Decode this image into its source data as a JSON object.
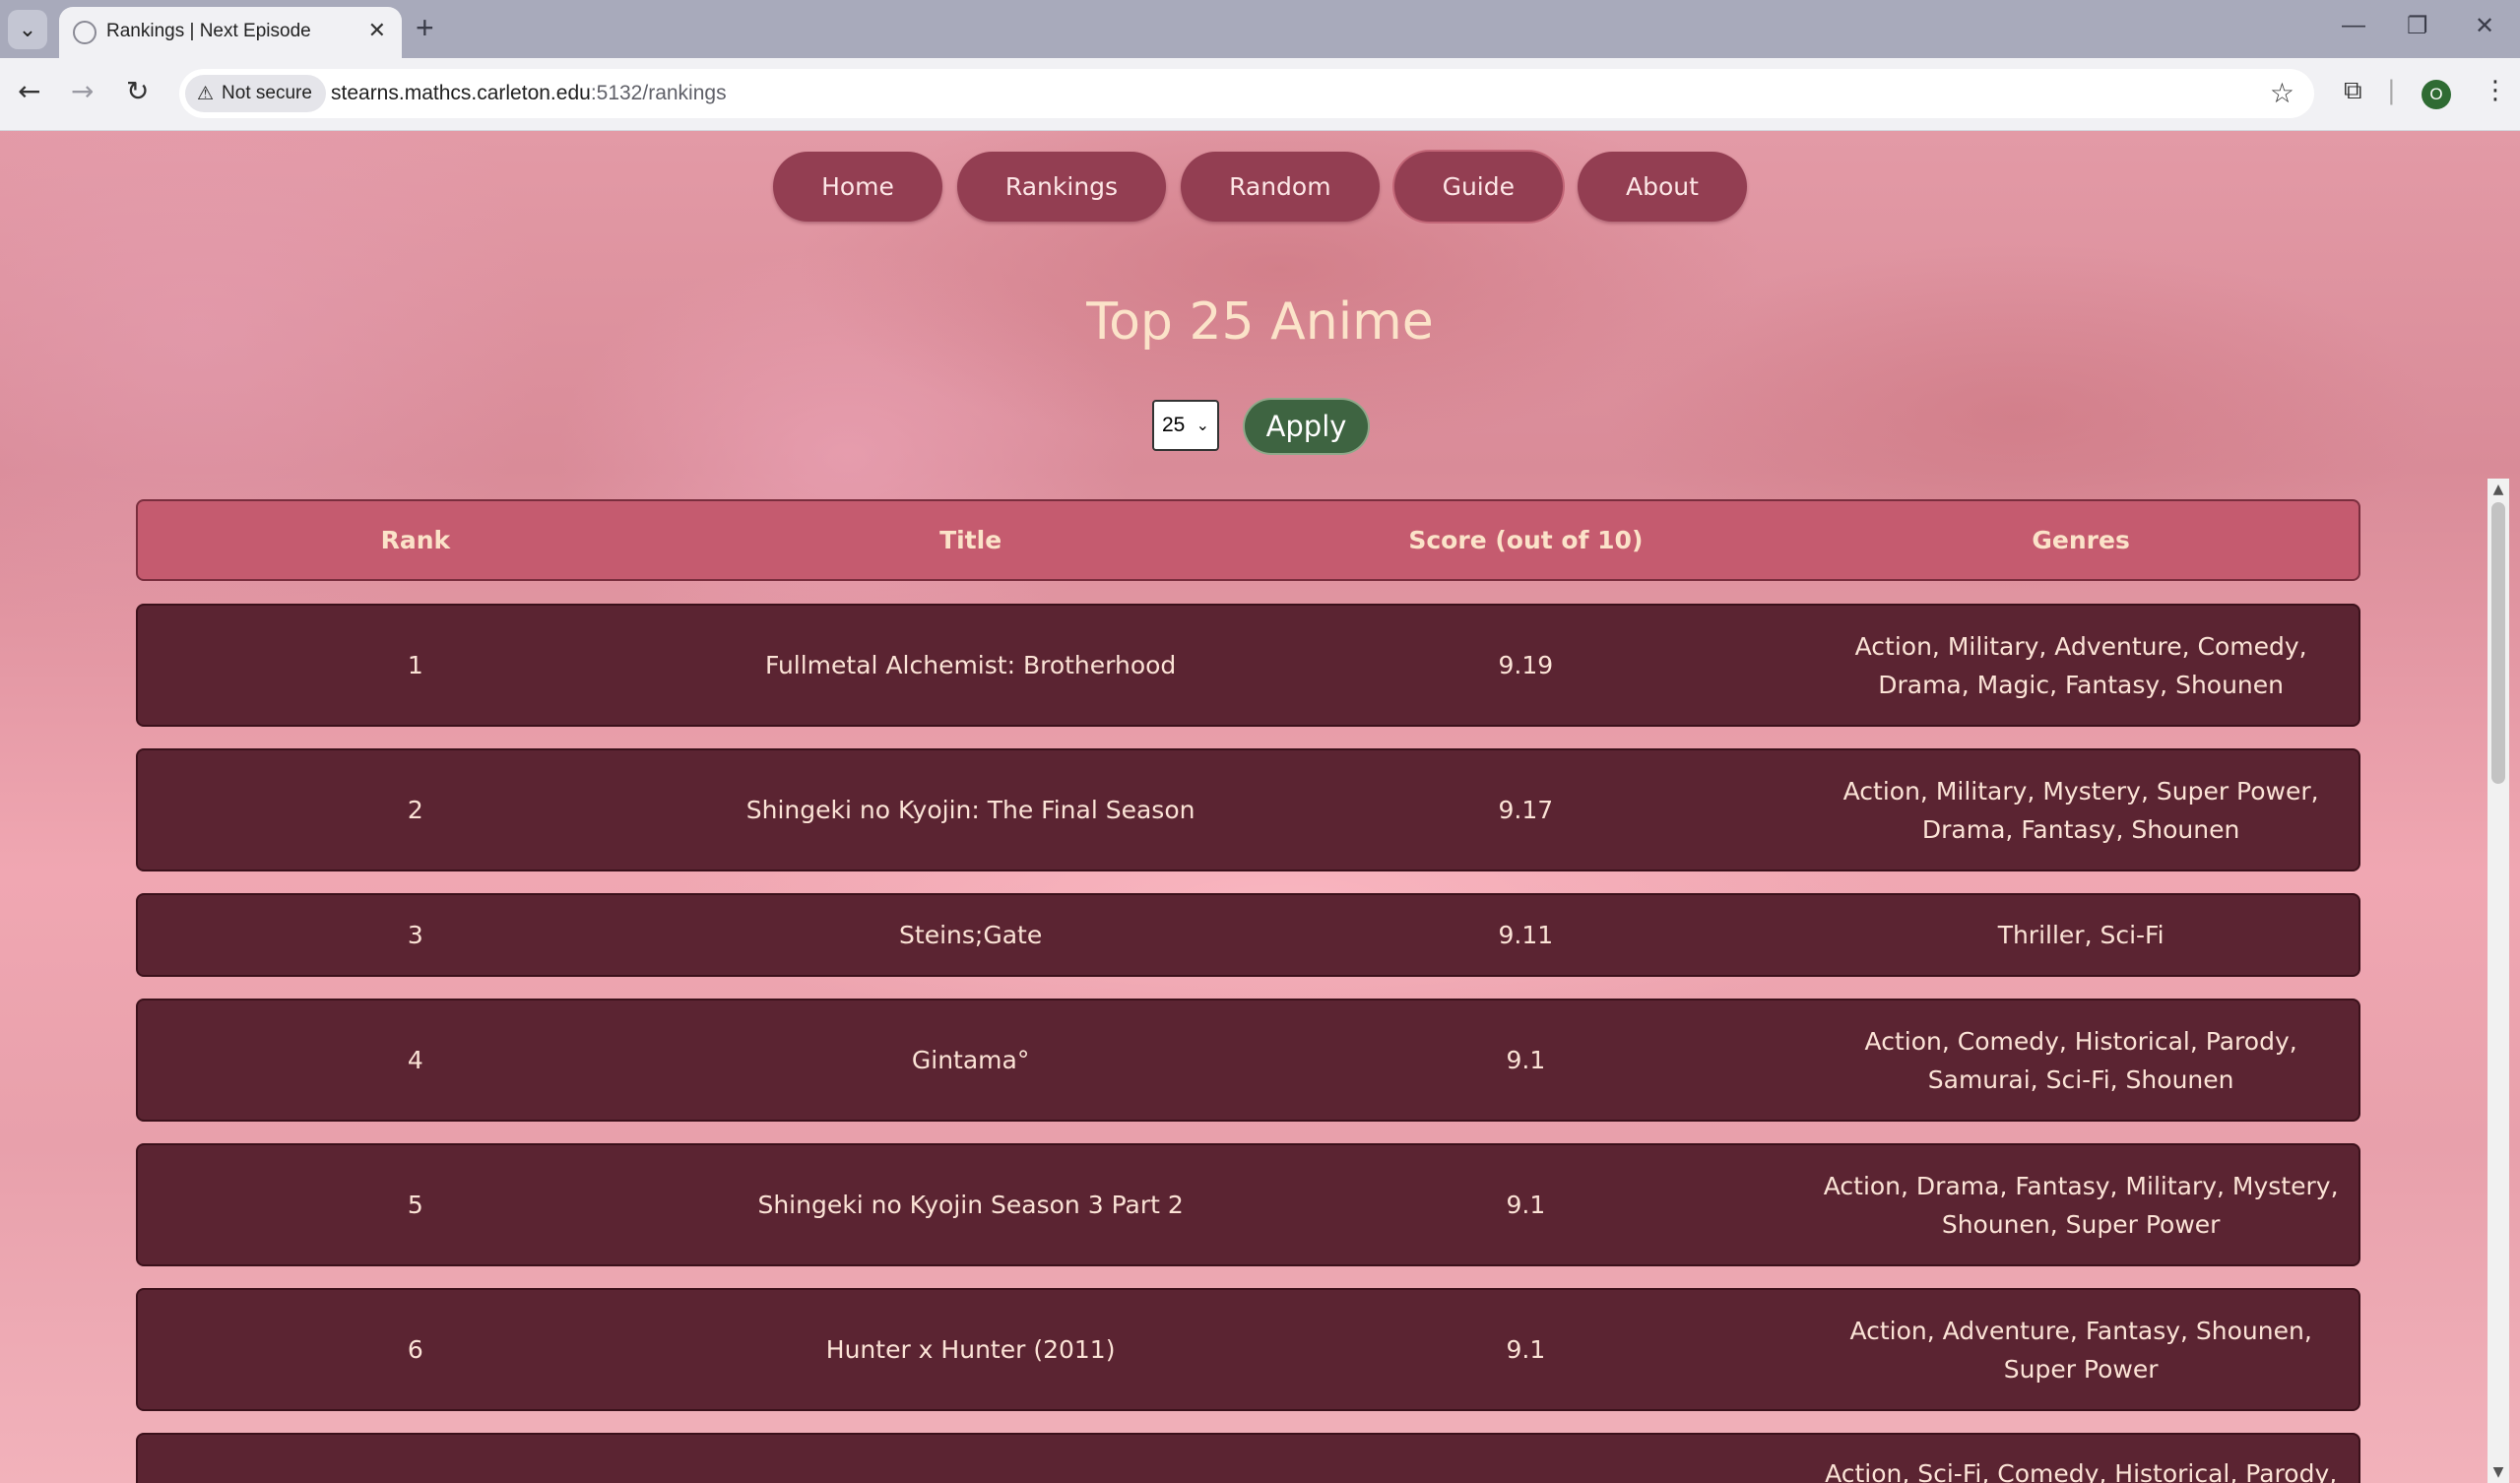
{
  "browser": {
    "tab_title": "Rankings | Next Episode",
    "new_tab_label": "+",
    "security_label": "Not secure",
    "url_host": "stearns.mathcs.carleton.edu",
    "url_path": ":5132/rankings",
    "profile_initial": "O"
  },
  "nav": {
    "items": [
      {
        "label": "Home"
      },
      {
        "label": "Rankings"
      },
      {
        "label": "Random"
      },
      {
        "label": "Guide"
      },
      {
        "label": "About"
      }
    ]
  },
  "page": {
    "title": "Top 25 Anime",
    "count_select_value": "25",
    "apply_label": "Apply"
  },
  "table": {
    "headers": {
      "rank": "Rank",
      "title": "Title",
      "score": "Score (out of 10)",
      "genres": "Genres"
    },
    "rows": [
      {
        "rank": "1",
        "title": "Fullmetal Alchemist: Brotherhood",
        "score": "9.19",
        "genres": "Action, Military, Adventure, Comedy, Drama, Magic, Fantasy, Shounen"
      },
      {
        "rank": "2",
        "title": "Shingeki no Kyojin: The Final Season",
        "score": "9.17",
        "genres": "Action, Military, Mystery, Super Power, Drama, Fantasy, Shounen"
      },
      {
        "rank": "3",
        "title": "Steins;Gate",
        "score": "9.11",
        "genres": "Thriller, Sci-Fi"
      },
      {
        "rank": "4",
        "title": "Gintama°",
        "score": "9.1",
        "genres": "Action, Comedy, Historical, Parody, Samurai, Sci-Fi, Shounen"
      },
      {
        "rank": "5",
        "title": "Shingeki no Kyojin Season 3 Part 2",
        "score": "9.1",
        "genres": "Action, Drama, Fantasy, Military, Mystery, Shounen, Super Power"
      },
      {
        "rank": "6",
        "title": "Hunter x Hunter (2011)",
        "score": "9.1",
        "genres": "Action, Adventure, Fantasy, Shounen, Super Power"
      },
      {
        "rank": "",
        "title": "",
        "score": "",
        "genres": "Action, Sci-Fi, Comedy, Historical, Parody,"
      }
    ]
  }
}
